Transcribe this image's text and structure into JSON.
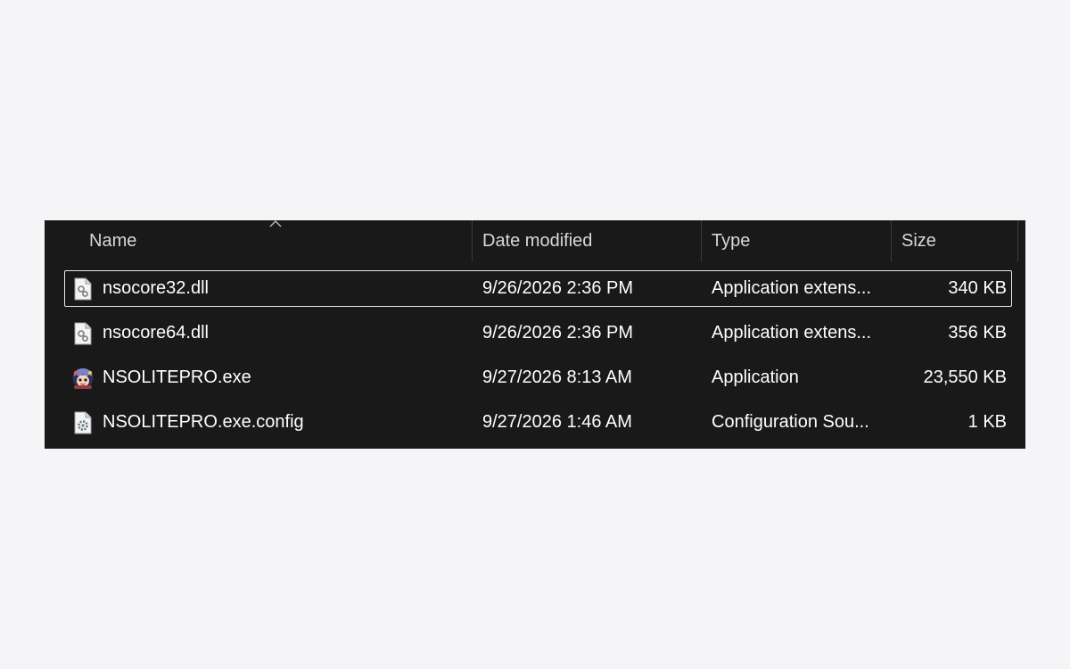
{
  "columns": {
    "name": "Name",
    "date": "Date modified",
    "type": "Type",
    "size": "Size"
  },
  "sort": {
    "column": "name",
    "icon": "chevron-up-icon"
  },
  "files": [
    {
      "name": "nsocore32.dll",
      "date": "9/26/2026 2:36 PM",
      "type": "Application extens...",
      "size": "340 KB",
      "icon": "dll-file-icon",
      "focused": true
    },
    {
      "name": "nsocore64.dll",
      "date": "9/26/2026 2:36 PM",
      "type": "Application extens...",
      "size": "356 KB",
      "icon": "dll-file-icon",
      "focused": false
    },
    {
      "name": "NSOLITEPRO.exe",
      "date": "9/27/2026 8:13 AM",
      "type": "Application",
      "size": "23,550 KB",
      "icon": "app-exe-icon",
      "focused": false
    },
    {
      "name": "NSOLITEPRO.exe.config",
      "date": "9/27/2026 1:46 AM",
      "type": "Configuration Sou...",
      "size": "1 KB",
      "icon": "config-file-icon",
      "focused": false
    }
  ],
  "colors": {
    "background": "#191919",
    "text": "#ffffff",
    "header_text": "#d8d8d8",
    "focus_border": "#e6e6e6"
  }
}
